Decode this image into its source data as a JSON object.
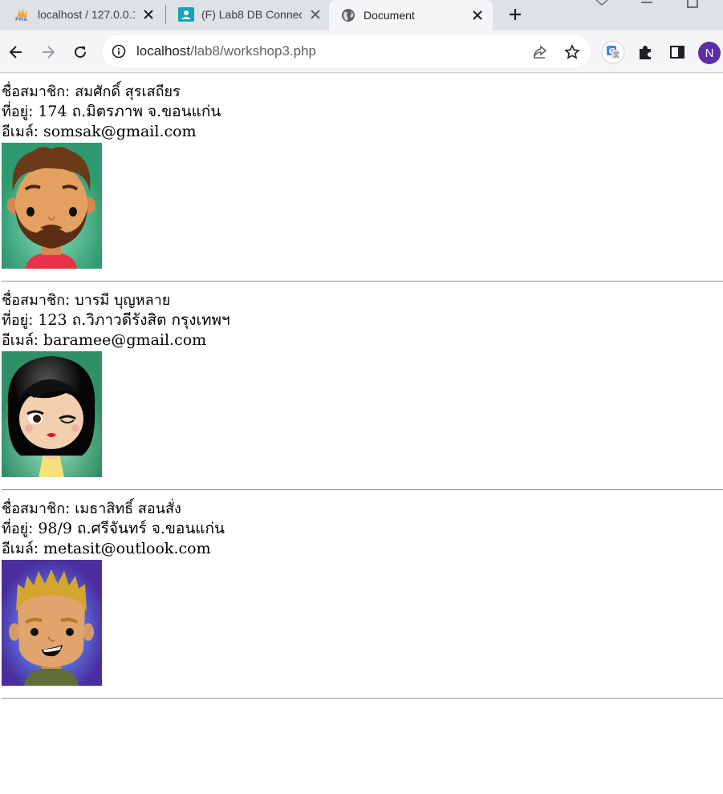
{
  "browser": {
    "tabs": [
      {
        "title": "localhost / 127.0.0.1",
        "favicon": "phpmyadmin-icon",
        "active": false
      },
      {
        "title": "(F) Lab8 DB Connection",
        "favicon": "classroom-icon",
        "active": false
      },
      {
        "title": "Document",
        "favicon": "globe-icon",
        "active": true
      }
    ],
    "url_host": "localhost",
    "url_path": "/lab8/workshop3.php",
    "profile_initial": "N",
    "accent_profile": "#5b2ea6"
  },
  "members": [
    {
      "name_label": "ชื่อสมาชิก:",
      "name": "สมศักดิ์ สุรเสถียร",
      "address_label": "ที่อยู่:",
      "address": "174 ถ.มิตรภาพ จ.ขอนแก่น",
      "email_label": "อีเมล์:",
      "email": "somsak@gmail.com",
      "avatar": "bearded-man-avatar",
      "avatar_bg": "#2f9a6f"
    },
    {
      "name_label": "ชื่อสมาชิก:",
      "name": "บารมี บุญหลาย",
      "address_label": "ที่อยู่:",
      "address": "123 ถ.วิภาวดีรังสิต กรุงเทพฯ",
      "email_label": "อีเมล์:",
      "email": "baramee@gmail.com",
      "avatar": "winking-woman-avatar",
      "avatar_bg": "#2f8f66"
    },
    {
      "name_label": "ชื่อสมาชิก:",
      "name": "เมธาสิทธิ์ สอนสั่ง",
      "address_label": "ที่อยู่:",
      "address": "98/9 ถ.ศรีจันทร์ จ.ขอนแก่น",
      "email_label": "อีเมล์:",
      "email": "metasit@outlook.com",
      "avatar": "blond-man-avatar",
      "avatar_bg": "#4b3aa8"
    }
  ]
}
